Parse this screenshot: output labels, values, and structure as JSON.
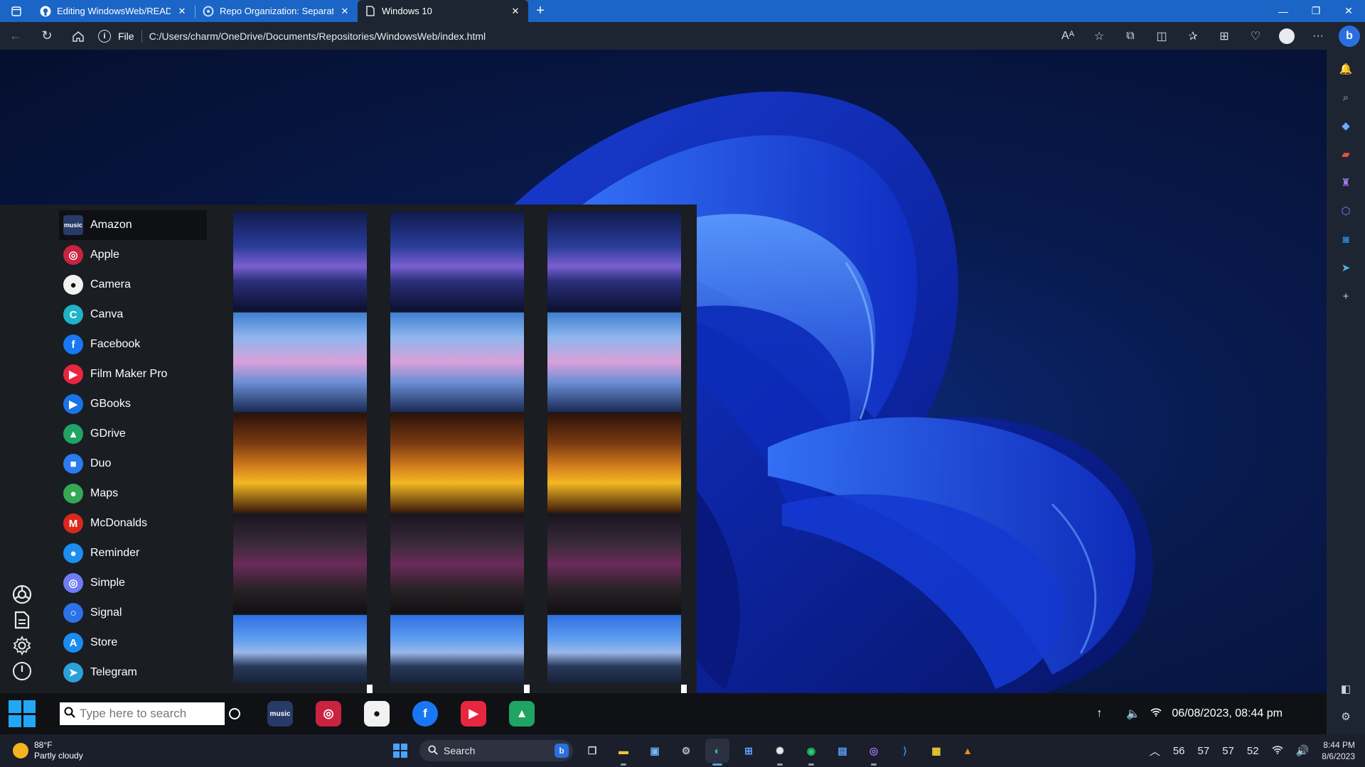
{
  "browser": {
    "tabs": [
      {
        "label": "Editing WindowsWeb/README.m",
        "icon": "github-icon",
        "active": false
      },
      {
        "label": "Repo Organization: Separate or",
        "icon": "chatgpt-icon",
        "active": false
      },
      {
        "label": "Windows 10",
        "icon": "document-icon",
        "active": true
      }
    ],
    "address": {
      "scheme_label": "File",
      "url": "C:/Users/charm/OneDrive/Documents/Repositories/WindowsWeb/index.html"
    }
  },
  "start_menu": {
    "apps": [
      {
        "label": "Amazon",
        "icon": "amazon-music-icon",
        "glyph": "music",
        "color": "#283a67"
      },
      {
        "label": "Apple",
        "icon": "apple-podcasts-icon",
        "glyph": "◎",
        "color": "#c8233f"
      },
      {
        "label": "Camera",
        "icon": "camera-icon",
        "glyph": "●",
        "color": "#f2f2f2"
      },
      {
        "label": "Canva",
        "icon": "canva-icon",
        "glyph": "C",
        "color": "#1fb3c8"
      },
      {
        "label": "Facebook",
        "icon": "facebook-icon",
        "glyph": "f",
        "color": "#1877f2"
      },
      {
        "label": "Film Maker Pro",
        "icon": "film-maker-icon",
        "glyph": "▶",
        "color": "#e8263f"
      },
      {
        "label": "GBooks",
        "icon": "google-books-icon",
        "glyph": "▶",
        "color": "#1a73e8"
      },
      {
        "label": "GDrive",
        "icon": "google-drive-icon",
        "glyph": "▲",
        "color": "#1fa463"
      },
      {
        "label": "Duo",
        "icon": "duo-icon",
        "glyph": "■",
        "color": "#2b7bf3"
      },
      {
        "label": "Maps",
        "icon": "maps-icon",
        "glyph": "●",
        "color": "#34a853"
      },
      {
        "label": "McDonalds",
        "icon": "mcdonalds-icon",
        "glyph": "M",
        "color": "#da291c"
      },
      {
        "label": "Reminder",
        "icon": "reminder-icon",
        "glyph": "●",
        "color": "#1c8ef0"
      },
      {
        "label": "Simple",
        "icon": "simple-icon",
        "glyph": "◎",
        "color": "#6f7cf5"
      },
      {
        "label": "Signal",
        "icon": "signal-icon",
        "glyph": "○",
        "color": "#2a72e8"
      },
      {
        "label": "Store",
        "icon": "app-store-icon",
        "glyph": "A",
        "color": "#1b8bf0"
      },
      {
        "label": "Telegram",
        "icon": "telegram-icon",
        "glyph": "➤",
        "color": "#2aa1db"
      }
    ],
    "rail": [
      "chrome-icon",
      "document-icon",
      "settings-icon",
      "power-icon"
    ],
    "tile_scenes": [
      "night-window-scene",
      "cherry-blossom-city-scene",
      "sunset-canyon-scene",
      "cyberpunk-street-scene",
      "countryside-house-scene"
    ]
  },
  "web_taskbar": {
    "search_placeholder": "Type here to search",
    "pinned": [
      {
        "name": "amazon-music-icon",
        "glyph": "music",
        "color": "#283a67"
      },
      {
        "name": "apple-podcasts-icon",
        "glyph": "◎",
        "color": "#c8233f"
      },
      {
        "name": "camera-icon",
        "glyph": "●",
        "color": "#f2f2f2"
      },
      {
        "name": "facebook-icon",
        "glyph": "f",
        "color": "#1877f2"
      },
      {
        "name": "film-maker-icon",
        "glyph": "▶",
        "color": "#e8263f"
      },
      {
        "name": "google-drive-icon",
        "glyph": "▲",
        "color": "#1fa463"
      }
    ],
    "datetime": "06/08/2023, 08:44 pm"
  },
  "os_taskbar": {
    "weather_temp": "88°F",
    "weather_desc": "Partly cloudy",
    "search_label": "Search",
    "tray_numbers": [
      "56",
      "57",
      "57",
      "52"
    ],
    "time": "8:44 PM",
    "date": "8/6/2023"
  },
  "colors": {
    "accent": "#1b65c6",
    "wallpaper": "#0b2a7a"
  }
}
